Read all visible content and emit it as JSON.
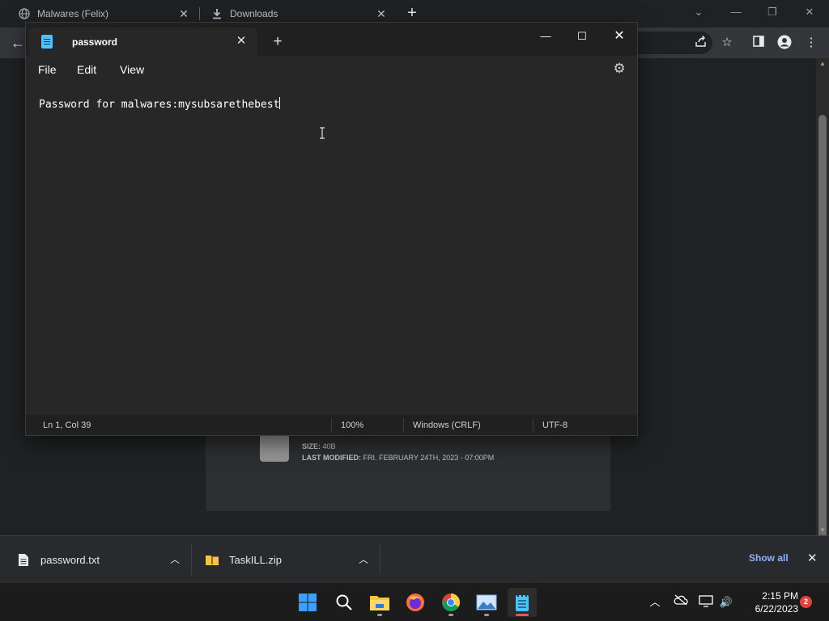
{
  "browser": {
    "tabs": [
      {
        "title": "Malwares (Felix)",
        "icon": "globe-icon"
      },
      {
        "title": "Downloads",
        "icon": "download-icon"
      }
    ],
    "window_controls": {
      "minimize": "—",
      "restore": "❐",
      "close": "✕"
    },
    "file_card": {
      "size_label": "SIZE:",
      "size_value": "40B",
      "modified_label": "LAST MODIFIED:",
      "modified_value": "FRI. FEBRUARY 24TH, 2023 - 07:00PM"
    }
  },
  "download_shelf": {
    "items": [
      {
        "name": "password.txt",
        "icon": "text-file-icon"
      },
      {
        "name": "TaskILL.zip",
        "icon": "zip-folder-icon"
      }
    ],
    "show_all": "Show all"
  },
  "notepad": {
    "tab_title": "password",
    "menu": {
      "file": "File",
      "edit": "Edit",
      "view": "View"
    },
    "content": "Password for malwares:mysubsarethebest",
    "status": {
      "position": "Ln 1, Col 39",
      "zoom": "100%",
      "line_ending": "Windows (CRLF)",
      "encoding": "UTF-8"
    }
  },
  "taskbar": {
    "apps": [
      "start-icon",
      "search-icon",
      "file-explorer-icon",
      "firefox-icon",
      "chrome-icon",
      "photos-icon",
      "notepad-icon"
    ],
    "time": "2:15 PM",
    "date": "6/22/2023",
    "notification_count": "2"
  },
  "colors": {
    "accent_blue": "#8ab4f8",
    "notepad_icon": "#4fc3f7",
    "start_blue": "#1e90ff"
  }
}
